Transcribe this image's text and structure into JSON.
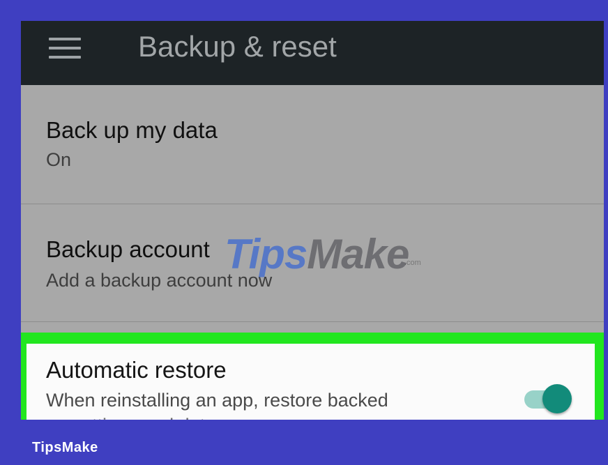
{
  "appbar": {
    "title": "Backup & reset",
    "menu_icon": "hamburger-menu-icon",
    "background_color": "#1d2326"
  },
  "preferences": [
    {
      "title": "Back up my data",
      "summary": "On"
    },
    {
      "title": "Backup account",
      "summary": "Add a backup account now"
    },
    {
      "title": "Automatic restore",
      "summary": "When reinstalling an app, restore backed",
      "summary_cut": "up settings and data",
      "toggle_on": true,
      "highlighted": true
    }
  ],
  "colors": {
    "frame_background": "#3f3fc1",
    "highlight_border": "#22e61f",
    "toggle_accent": "#128b7a"
  },
  "watermark": {
    "tips": "Tips",
    "make": "Make",
    "suffix": ".com"
  },
  "footer": {
    "brand": "TipsMake"
  }
}
